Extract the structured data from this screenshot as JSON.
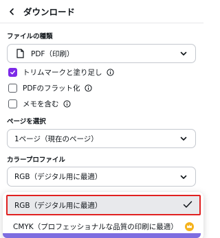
{
  "header": {
    "title": "ダウンロード"
  },
  "file_type": {
    "label": "ファイルの種類",
    "value": "PDF（印刷）"
  },
  "options": [
    {
      "label": "トリムマークと塗り足し",
      "checked": true
    },
    {
      "label": "PDFのフラット化",
      "checked": false
    },
    {
      "label": "メモを含む",
      "checked": false
    }
  ],
  "page_select": {
    "label": "ページを選択",
    "value": "1ページ（現在のページ）"
  },
  "color_profile": {
    "label": "カラープロファイル",
    "value": "RGB（デジタル用に最適）",
    "dropdown": [
      {
        "label": "RGB（デジタル用に最適）",
        "selected": true
      },
      {
        "label": "CMYK（プロフェッショナルな品質の印刷に最適）",
        "selected": false,
        "premium": true
      }
    ]
  },
  "colors": {
    "accent": "#7d2ae8",
    "highlight_border": "#e02020",
    "premium": "#f5b21b"
  }
}
